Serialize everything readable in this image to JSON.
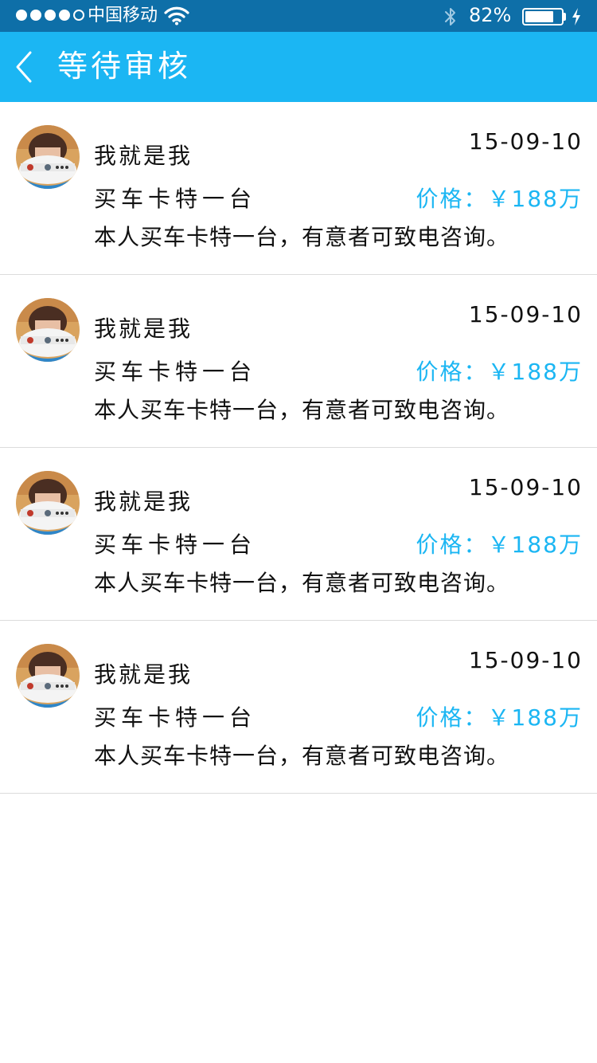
{
  "status_bar": {
    "carrier": "中国移动",
    "battery_percent": "82%",
    "battery_level": 0.82,
    "signal_bars_filled": 4,
    "signal_bars_total": 5
  },
  "header": {
    "title": "等待审核"
  },
  "theme": {
    "accent": "#1bb6f3",
    "status_bar_bg": "#0e6fa8",
    "text": "#111111",
    "divider": "#dcdcdc"
  },
  "items": [
    {
      "name": "我就是我",
      "date": "15-09-10",
      "title": "买车卡特一台",
      "price_label": "价格：",
      "price_value": "￥188万",
      "description": "本人买车卡特一台，有意者可致电咨询。"
    },
    {
      "name": "我就是我",
      "date": "15-09-10",
      "title": "买车卡特一台",
      "price_label": "价格：",
      "price_value": "￥188万",
      "description": "本人买车卡特一台，有意者可致电咨询。"
    },
    {
      "name": "我就是我",
      "date": "15-09-10",
      "title": "买车卡特一台",
      "price_label": "价格：",
      "price_value": "￥188万",
      "description": "本人买车卡特一台，有意者可致电咨询。"
    },
    {
      "name": "我就是我",
      "date": "15-09-10",
      "title": "买车卡特一台",
      "price_label": "价格：",
      "price_value": "￥188万",
      "description": "本人买车卡特一台，有意者可致电咨询。"
    }
  ]
}
